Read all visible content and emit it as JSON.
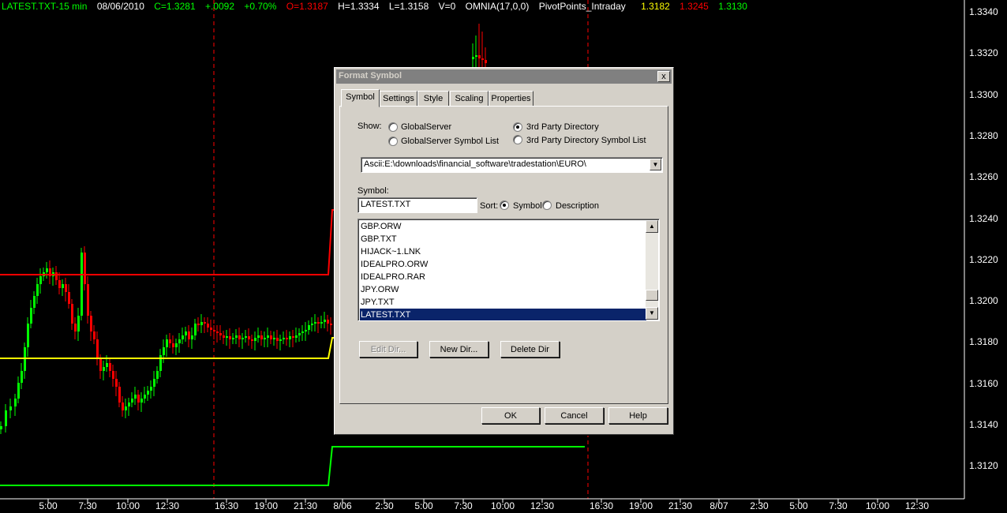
{
  "header": {
    "symbol": "LATEST.TXT-15 min",
    "date": "08/06/2010",
    "close": "C=1.3281",
    "change": "+.0092",
    "change_pct": "+0.70%",
    "open": "O=1.3187",
    "high": "H=1.3334",
    "low": "L=1.3158",
    "volume": "V=0",
    "indicator1": "OMNIA(17,0,0)",
    "indicator2": "PivotPoints_Intraday",
    "pivot": "1.3182",
    "resistance": "1.3245",
    "support": "1.3130"
  },
  "colors": {
    "up": "#00ff00",
    "down": "#ff0000",
    "pivot": "#ffff00",
    "background": "#000000"
  },
  "price_axis": [
    "1.3340",
    "1.3320",
    "1.3300",
    "1.3280",
    "1.3260",
    "1.3240",
    "1.3220",
    "1.3200",
    "1.3180",
    "1.3160",
    "1.3140",
    "1.3120"
  ],
  "time_axis": [
    "5:00",
    "7:30",
    "10:00",
    "12:30",
    "16:30",
    "19:00",
    "21:30",
    "8/06",
    "2:30",
    "5:00",
    "7:30",
    "10:00",
    "12:30",
    "16:30",
    "19:00",
    "21:30",
    "8/07",
    "2:30",
    "5:00",
    "7:30",
    "10:00",
    "12:30"
  ],
  "dialog": {
    "title": "Format Symbol",
    "close_glyph": "x",
    "tabs": [
      "Symbol",
      "Settings",
      "Style",
      "Scaling",
      "Properties"
    ],
    "show_label": "Show:",
    "show_options": [
      "GlobalServer",
      "GlobalServer Symbol List",
      "3rd Party Directory",
      "3rd Party Directory Symbol List"
    ],
    "show_selected": "3rd Party Directory",
    "directory": "Ascii:E:\\downloads\\financial_software\\tradestation\\EURO\\",
    "symbol_label": "Symbol:",
    "symbol_value": "LATEST.TXT",
    "sort_label": "Sort:",
    "sort_options": [
      "Symbol",
      "Description"
    ],
    "sort_selected": "Symbol",
    "files": [
      "GBP.ORW",
      "GBP.TXT",
      "HIJACK~1.LNK",
      "IDEALPRO.ORW",
      "IDEALPRO.RAR",
      "JPY.ORW",
      "JPY.TXT",
      "LATEST.TXT"
    ],
    "selected_file": "LATEST.TXT",
    "edit_dir": "Edit Dir...",
    "new_dir": "New Dir...",
    "delete_dir": "Delete Dir",
    "ok": "OK",
    "cancel": "Cancel",
    "help": "Help"
  }
}
